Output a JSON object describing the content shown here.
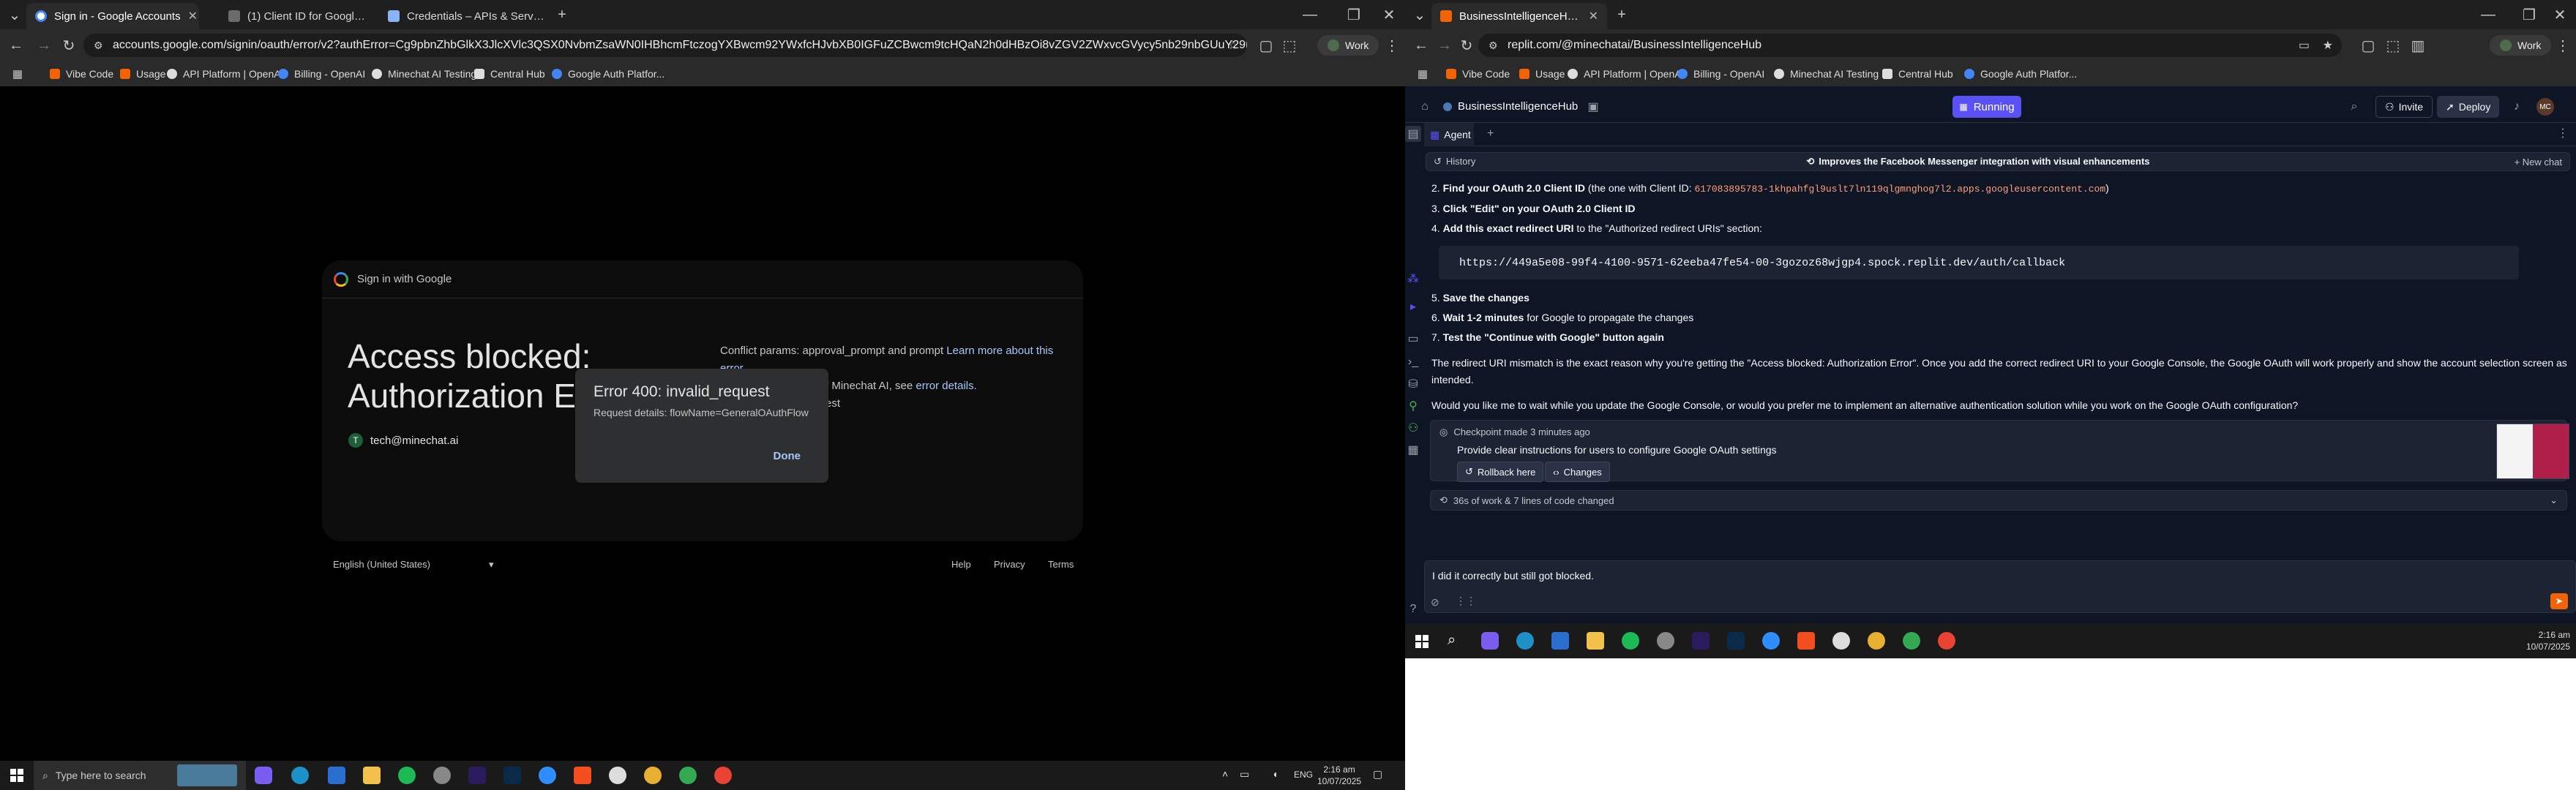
{
  "left_window": {
    "tabs": [
      {
        "label": "Sign in - Google Accounts",
        "active": true
      },
      {
        "label": "(1) Client ID for Google OAuth - ...",
        "active": false
      },
      {
        "label": "Credentials – APIs & Services –...",
        "active": false
      }
    ],
    "new_tab": "+",
    "url": "accounts.google.com/signin/oauth/error/v2?authError=Cg9pbnZhbGlkX3JlcXVlc3QSX0NvbmZsaWN0IHBhcmFtczogYXBwcm92YWxfcHJvbXB0IGFuZCBwcm9tcHQaN2h0dHBzOi8vZGV2ZWxvcGVycy5nb29nbGUuY29tL2lkZW50aXR5L3Byb3RvY2...",
    "profile_label": "Work",
    "bookmarks": [
      "Vibe Code",
      "Usage",
      "API Platform | OpenAI",
      "Billing - OpenAI",
      "Minechat AI Testing",
      "Central Hub",
      "Google Auth Platfor..."
    ],
    "google": {
      "header": "Sign in with Google",
      "title_line1": "Access blocked:",
      "title_line2": "Authorization Er",
      "account": "tech@minechat.ai",
      "account_initial": "T",
      "conflict_prefix": "Conflict params: approval_prompt and prompt",
      "learn_more": "Learn more about this",
      "learn_more_2": "error",
      "partial_line_prefix": "f Minechat AI, see",
      "error_details": "error details.",
      "partial_line_2": "est"
    },
    "error_popup": {
      "title": "Error 400: invalid_request",
      "details": "Request details: flowName=GeneralOAuthFlow",
      "done": "Done"
    },
    "footer": {
      "language": "English (United States)",
      "help": "Help",
      "privacy": "Privacy",
      "terms": "Terms"
    },
    "taskbar": {
      "search_placeholder": "Type here to search",
      "lang": "ENG",
      "time": "2:16 am",
      "date": "10/07/2025"
    }
  },
  "right_window": {
    "tab": {
      "label": "BusinessIntelligenceHub - Repli..."
    },
    "url": "replit.com/@minechatai/BusinessIntelligenceHub",
    "profile_label": "Work",
    "bookmarks": [
      "Vibe Code",
      "Usage",
      "API Platform | OpenAI",
      "Billing - OpenAI",
      "Minechat AI Testing",
      "Central Hub",
      "Google Auth Platfor..."
    ],
    "project_name": "BusinessIntelligenceHub",
    "running_label": "Running",
    "invite_label": "Invite",
    "deploy_label": "Deploy",
    "avatar_initials": "MC",
    "agent_tab": "Agent",
    "history_label": "History",
    "improvement_title": "Improves the Facebook Messenger integration with visual enhancements",
    "new_chat": "+ New chat",
    "steps": [
      {
        "n": "2.",
        "bold": "Find your OAuth 2.0 Client ID",
        "rest": " (the one with Client ID: ",
        "code": "617083895783-1khpahfgl9uslt7ln119qlgmnghog7l2.apps.googleusercontent.com",
        "tail": ")"
      },
      {
        "n": "3.",
        "bold": "Click \"Edit\" on your OAuth 2.0 Client ID",
        "rest": "",
        "code": "",
        "tail": ""
      },
      {
        "n": "4.",
        "bold": "Add this exact redirect URI",
        "rest": " to the \"Authorized redirect URIs\" section:",
        "code": "",
        "tail": ""
      }
    ],
    "redirect_uri": "https://449a5e08-99f4-4100-9571-62eeba47fe54-00-3gozoz68wjgp4.spock.replit.dev/auth/callback",
    "steps2": [
      {
        "n": "5.",
        "bold": "Save the changes",
        "rest": ""
      },
      {
        "n": "6.",
        "bold": "Wait 1-2 minutes",
        "rest": " for Google to propagate the changes"
      },
      {
        "n": "7.",
        "bold": "Test the \"Continue with Google\" button again",
        "rest": ""
      }
    ],
    "para1": "The redirect URI mismatch is the exact reason why you're getting the \"Access blocked: Authorization Error\". Once you add the correct redirect URI to your Google Console, the Google OAuth will work properly and show the account selection screen as intended.",
    "para2": "Would you like me to wait while you update the Google Console, or would you prefer me to implement an alternative authentication solution while you work on the Google OAuth configuration?",
    "checkpoint": {
      "label": "Checkpoint made 3 minutes ago",
      "description": "Provide clear instructions for users to configure Google OAuth settings",
      "rollback": "Rollback here",
      "changes": "Changes"
    },
    "work_summary": "36s of work & 7 lines of code changed",
    "input_text": "I did it correctly but still got blocked.",
    "taskbar": {
      "time": "2:16 am",
      "date": "10/07/2025"
    }
  },
  "colors": {
    "replit_bg": "#0e1525",
    "accent_purple": "#5b50f5",
    "send_orange": "#f26207",
    "link_blue": "#a8c7fa"
  }
}
